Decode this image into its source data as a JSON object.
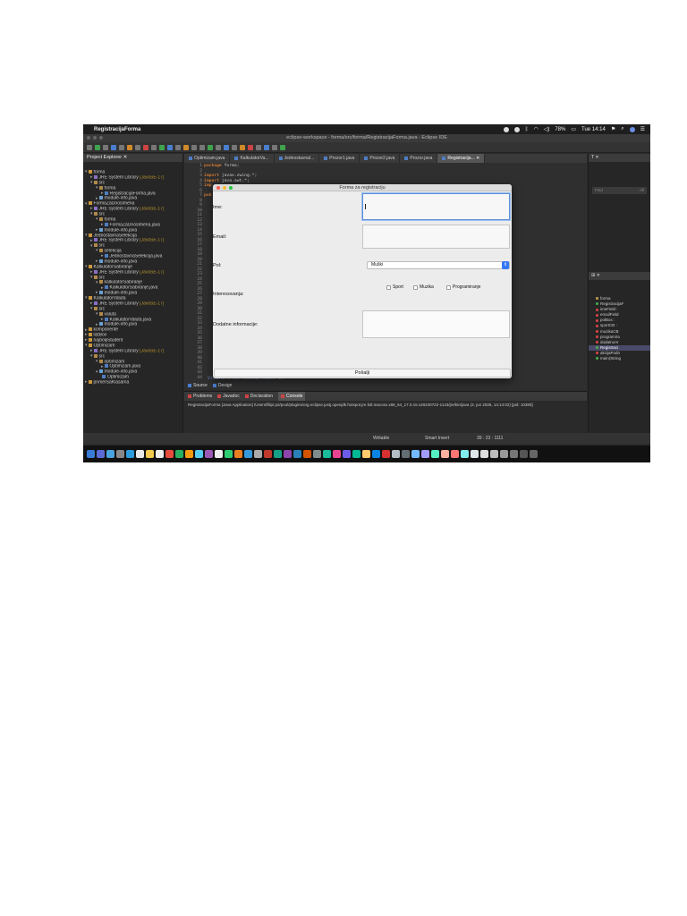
{
  "menubar": {
    "app_name": "RegistracijaForma",
    "battery": "78%",
    "clock": "Tue 14:14"
  },
  "window": {
    "title": "eclipse-workspace - forma/src/forma/RegistracijaForma.java - Eclipse IDE"
  },
  "explorer": {
    "title": "Project Explorer",
    "tree": [
      {
        "indent": 0,
        "twisty": "▾",
        "icon": "proj",
        "label": "forma"
      },
      {
        "indent": 1,
        "twisty": "▸",
        "icon": "lib",
        "label": "JRE System Library",
        "suffix": "[JavaSE-17]"
      },
      {
        "indent": 1,
        "twisty": "▾",
        "icon": "pkg",
        "label": "src"
      },
      {
        "indent": 2,
        "twisty": "▾",
        "icon": "pkg",
        "label": "forma"
      },
      {
        "indent": 3,
        "twisty": "▸",
        "icon": "java",
        "label": "RegistracijaForma.java"
      },
      {
        "indent": 2,
        "twisty": "▸",
        "icon": "mod",
        "label": "module-info.java"
      },
      {
        "indent": 0,
        "twisty": "▾",
        "icon": "proj",
        "label": "FormaZaUnosImena"
      },
      {
        "indent": 1,
        "twisty": "▸",
        "icon": "lib",
        "label": "JRE System Library",
        "suffix": "[JavaSE-17]"
      },
      {
        "indent": 1,
        "twisty": "▾",
        "icon": "pkg",
        "label": "src"
      },
      {
        "indent": 2,
        "twisty": "▾",
        "icon": "pkg",
        "label": "forma"
      },
      {
        "indent": 3,
        "twisty": "▸",
        "icon": "java",
        "label": "FormaZaUnosImena.java"
      },
      {
        "indent": 2,
        "twisty": "▸",
        "icon": "mod",
        "label": "module-info.java"
      },
      {
        "indent": 0,
        "twisty": "▾",
        "icon": "proj",
        "label": "JednostavnaSelekcija"
      },
      {
        "indent": 1,
        "twisty": "▸",
        "icon": "lib",
        "label": "JRE System Library",
        "suffix": "[JavaSE-17]"
      },
      {
        "indent": 1,
        "twisty": "▾",
        "icon": "pkg",
        "label": "src"
      },
      {
        "indent": 2,
        "twisty": "▾",
        "icon": "pkg",
        "label": "selekcija"
      },
      {
        "indent": 3,
        "twisty": "▸",
        "icon": "java",
        "label": "JednostavnaSelekcija.java"
      },
      {
        "indent": 2,
        "twisty": "▸",
        "icon": "mod",
        "label": "module-info.java"
      },
      {
        "indent": 0,
        "twisty": "▾",
        "icon": "proj",
        "label": "KalkulatorSabiranje"
      },
      {
        "indent": 1,
        "twisty": "▸",
        "icon": "lib",
        "label": "JRE System Library",
        "suffix": "[JavaSE-17]"
      },
      {
        "indent": 1,
        "twisty": "▾",
        "icon": "pkg",
        "label": "src"
      },
      {
        "indent": 2,
        "twisty": "▾",
        "icon": "pkg",
        "label": "kalkulatorSabiranje"
      },
      {
        "indent": 3,
        "twisty": "▸",
        "icon": "java",
        "label": "KalkulatorSabiranje.java"
      },
      {
        "indent": 2,
        "twisty": "▸",
        "icon": "mod",
        "label": "module-info.java"
      },
      {
        "indent": 0,
        "twisty": "▾",
        "icon": "proj",
        "label": "KalkulatorValuta"
      },
      {
        "indent": 1,
        "twisty": "▸",
        "icon": "lib",
        "label": "JRE System Library",
        "suffix": "[JavaSE-17]"
      },
      {
        "indent": 1,
        "twisty": "▾",
        "icon": "pkg",
        "label": "src"
      },
      {
        "indent": 2,
        "twisty": "▾",
        "icon": "pkg",
        "label": "valuta"
      },
      {
        "indent": 3,
        "twisty": "▸",
        "icon": "java",
        "label": "KalkulatorValuta.java"
      },
      {
        "indent": 2,
        "twisty": "▸",
        "icon": "mod",
        "label": "module-info.java"
      },
      {
        "indent": 0,
        "twisty": "▸",
        "icon": "proj",
        "label": "komponente"
      },
      {
        "indent": 0,
        "twisty": "▸",
        "icon": "proj",
        "label": "listBox"
      },
      {
        "indent": 0,
        "twisty": "▸",
        "icon": "proj",
        "label": "najboljiStudent"
      },
      {
        "indent": 0,
        "twisty": "▾",
        "icon": "proj",
        "label": "Optimizam"
      },
      {
        "indent": 1,
        "twisty": "▸",
        "icon": "lib",
        "label": "JRE System Library",
        "suffix": "[JavaSE-17]"
      },
      {
        "indent": 1,
        "twisty": "▾",
        "icon": "pkg",
        "label": "src"
      },
      {
        "indent": 2,
        "twisty": "▾",
        "icon": "pkg",
        "label": "optimizam"
      },
      {
        "indent": 3,
        "twisty": "▸",
        "icon": "java",
        "label": "Optimizam.java"
      },
      {
        "indent": 2,
        "twisty": "▾",
        "icon": "mod",
        "label": "module-info.java"
      },
      {
        "indent": 3,
        "twisty": "",
        "icon": "java",
        "label": "Optimizam"
      },
      {
        "indent": 0,
        "twisty": "▸",
        "icon": "proj",
        "label": "primerSaKlasama"
      }
    ]
  },
  "editor": {
    "tabs": [
      {
        "label": "Optimizam.java",
        "active": false
      },
      {
        "label": "KalkulatorVa...",
        "active": false
      },
      {
        "label": "Jednostavnal...",
        "active": false
      },
      {
        "label": "Prozor1.java",
        "active": false
      },
      {
        "label": "Prozor2.java",
        "active": false
      },
      {
        "label": "Prozor.java",
        "active": false
      },
      {
        "label": "Registracija...",
        "active": true
      }
    ],
    "code_lines": [
      {
        "kw": "package",
        "text": " forma;"
      },
      {
        "kw": "",
        "text": ""
      },
      {
        "kw": "import",
        "text": " javax.swing.*;"
      },
      {
        "kw": "import",
        "text": " java.awt.*;"
      },
      {
        "kw": "imp",
        "text": ""
      },
      {
        "kw": "",
        "text": ""
      },
      {
        "kw": "pub",
        "text": ""
      }
    ],
    "footer_code": "Visible = (of Schema) Model is",
    "bottom_tabs": [
      "Source",
      "Design"
    ]
  },
  "console": {
    "tabs": [
      {
        "label": "Problems",
        "active": false
      },
      {
        "label": "Javadoc",
        "active": false
      },
      {
        "label": "Declaration",
        "active": false
      },
      {
        "label": "Console",
        "active": true
      }
    ],
    "text": "RegistracijaForma [Java Application] /Users/filip/.p2/pool/plugins/org.eclipse.justj.openjdk.hotspot.jre.full.macosx.x86_64_17.0.15.v20240722-1143/jre/bin/java (3. jun 2025, 14:14:02) [pid: 10380]"
  },
  "outline": {
    "find_placeholder": "Find",
    "find_all": "All",
    "items": [
      {
        "label": "forma",
        "marker": "pkg",
        "selected": false
      },
      {
        "label": "RegistracijaF",
        "marker": "class",
        "selected": false
      },
      {
        "label": "imeField :",
        "marker": "red",
        "selected": false
      },
      {
        "label": "emailField",
        "marker": "red",
        "selected": false
      },
      {
        "label": "polBox :",
        "marker": "red",
        "selected": false
      },
      {
        "label": "sportCB :",
        "marker": "red",
        "selected": false
      },
      {
        "label": "muzikaCB",
        "marker": "red",
        "selected": false
      },
      {
        "label": "programira",
        "marker": "red",
        "selected": false
      },
      {
        "label": "dodatnoAr",
        "marker": "red",
        "selected": false
      },
      {
        "label": "Registraci",
        "marker": "green",
        "selected": true
      },
      {
        "label": "akcijaPodn",
        "marker": "red",
        "selected": false
      },
      {
        "label": "main(String",
        "marker": "green",
        "selected": false
      }
    ]
  },
  "status": {
    "writable": "Writable",
    "insert_mode": "Smart Insert",
    "cursor": "39 : 23 : 1111"
  },
  "dialog": {
    "title": "Forma za registraciju",
    "labels": {
      "ime": "Ime:",
      "email": "Email:",
      "pol": "Pol:",
      "interesovanja": "Interesovanja:",
      "dodatne": "Dodatne informacije:"
    },
    "fields": {
      "ime_value": "",
      "email_value": "",
      "dodatne_value": ""
    },
    "pol_selected": "Muški",
    "checkboxes": [
      {
        "label": "Sport",
        "checked": false
      },
      {
        "label": "Muzika",
        "checked": false
      },
      {
        "label": "Programiranje",
        "checked": false
      }
    ],
    "submit_label": "Pošalji"
  },
  "colors": {
    "ide_background": "#2b2b2b",
    "keyword": "#cc7832",
    "dialog_background": "#ececec",
    "select_arrow": "#3478f6"
  }
}
